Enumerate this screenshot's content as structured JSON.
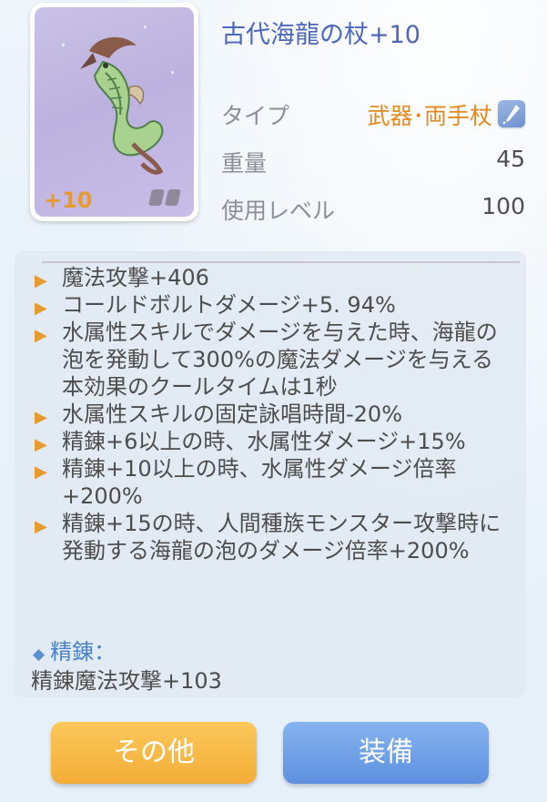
{
  "item": {
    "name": "古代海龍の杖+10",
    "refine_badge": "+10",
    "icon": "sea-dragon-staff-icon"
  },
  "stats": {
    "type_label": "タイプ",
    "type_value": "武器･両手杖",
    "type_icon": "staff-type-icon",
    "weight_label": "重量",
    "weight_value": "45",
    "level_label": "使用レベル",
    "level_value": "100"
  },
  "effects": [
    {
      "text": "魔法攻撃+406"
    },
    {
      "text": "コールドボルトダメージ+5. 94%"
    },
    {
      "text": "水属性スキルでダメージを与えた時、海龍の泡を発動して300%の魔法ダメージを与える"
    },
    {
      "text": "本効果のクールタイムは1秒",
      "note": true
    },
    {
      "text": "水属性スキルの固定詠唱時間-20%"
    },
    {
      "text": "精錬+6以上の時、水属性ダメージ+15%"
    },
    {
      "text": "精錬+10以上の時、水属性ダメージ倍率+200%"
    },
    {
      "text": "精錬+15の時、人間種族モンスター攻撃時に発動する海龍の泡のダメージ倍率+200%"
    }
  ],
  "refine": {
    "header": "精錬：",
    "line": "精錬魔法攻撃+103"
  },
  "buttons": {
    "other": "その他",
    "equip": "装備"
  },
  "colors": {
    "accent_orange": "#e79a2e",
    "title_blue": "#4f67b7",
    "button_yellow": "#f3ad37",
    "button_blue": "#5e90e0"
  }
}
